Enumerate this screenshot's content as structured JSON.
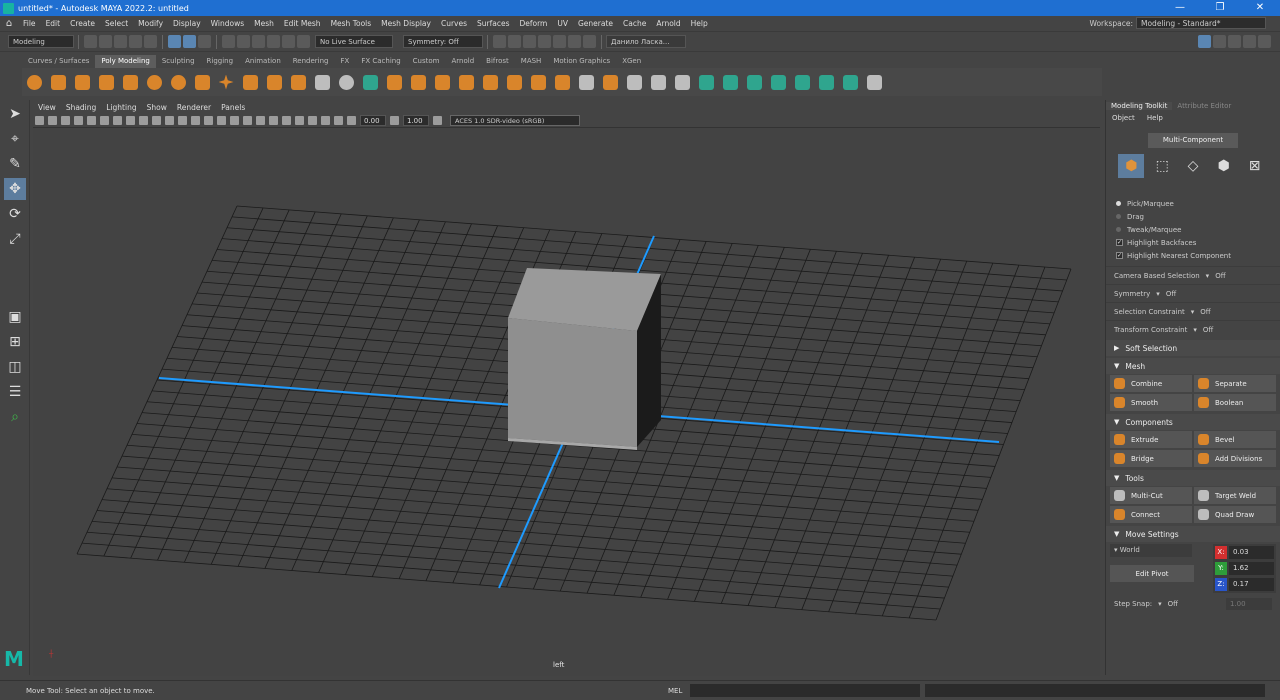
{
  "window": {
    "title": "untitled* - Autodesk MAYA 2022.2: untitled",
    "buttons": [
      "—",
      "❐",
      "✕"
    ]
  },
  "menubar": {
    "items": [
      "File",
      "Edit",
      "Create",
      "Select",
      "Modify",
      "Display",
      "Windows",
      "Mesh",
      "Edit Mesh",
      "Mesh Tools",
      "Mesh Display",
      "Curves",
      "Surfaces",
      "Deform",
      "UV",
      "Generate",
      "Cache",
      "Arnold",
      "Help"
    ],
    "workspace_label": "Workspace:",
    "workspace_value": "Modeling - Standard*"
  },
  "statusline": {
    "mode": "Modeling",
    "live_surface": "No Live Surface",
    "symmetry": "Symmetry: Off",
    "user": "Данило Ласка..."
  },
  "shelf": {
    "tabs": [
      "Curves / Surfaces",
      "Poly Modeling",
      "Sculpting",
      "Rigging",
      "Animation",
      "Rendering",
      "FX",
      "FX Caching",
      "Custom",
      "Arnold",
      "Bifrost",
      "MASH",
      "Motion Graphics",
      "XGen"
    ],
    "active_tab": "Poly Modeling"
  },
  "panel": {
    "menus": [
      "View",
      "Shading",
      "Lighting",
      "Show",
      "Renderer",
      "Panels"
    ],
    "exposure": "0.00",
    "gamma": "1.00",
    "color_management": "ACES 1.0 SDR-video (sRGB)",
    "camera_name": "left"
  },
  "toolkit": {
    "tabs": [
      "Modeling Toolkit",
      "Attribute Editor"
    ],
    "menus": [
      "Object",
      "Help"
    ],
    "multi_component": "Multi-Component",
    "pick_options": [
      "Pick/Marquee",
      "Drag",
      "Tweak/Marquee"
    ],
    "checks": [
      "Highlight Backfaces",
      "Highlight Nearest Component"
    ],
    "props": [
      {
        "label": "Camera Based Selection",
        "value": "Off"
      },
      {
        "label": "Symmetry",
        "value": "Off"
      },
      {
        "label": "Selection Constraint",
        "value": "Off"
      },
      {
        "label": "Transform Constraint",
        "value": "Off"
      }
    ],
    "soft_selection": "Soft Selection",
    "sections": {
      "mesh": {
        "title": "Mesh",
        "buttons": [
          "Combine",
          "Separate",
          "Smooth",
          "Boolean"
        ]
      },
      "components": {
        "title": "Components",
        "buttons": [
          "Extrude",
          "Bevel",
          "Bridge",
          "Add Divisions"
        ]
      },
      "tools": {
        "title": "Tools",
        "buttons": [
          "Multi-Cut",
          "Target Weld",
          "Connect",
          "Quad Draw"
        ]
      }
    },
    "move_settings": {
      "title": "Move Settings",
      "space": "World",
      "edit_pivot": "Edit Pivot",
      "x": "0.03",
      "y": "1.62",
      "z": "0.17"
    },
    "step_snap": {
      "label": "Step Snap:",
      "value": "Off",
      "amount": "1.00"
    }
  },
  "statusbar": {
    "message": "Move Tool: Select an object to move.",
    "mel": "MEL"
  },
  "colors": {
    "title_blue": "#1f6fd1",
    "axis_blue": "#1e9bff",
    "accent_orange": "#d9852b",
    "x_red": "#d32f2f",
    "y_green": "#2e9d3a",
    "z_blue": "#2955c9"
  }
}
